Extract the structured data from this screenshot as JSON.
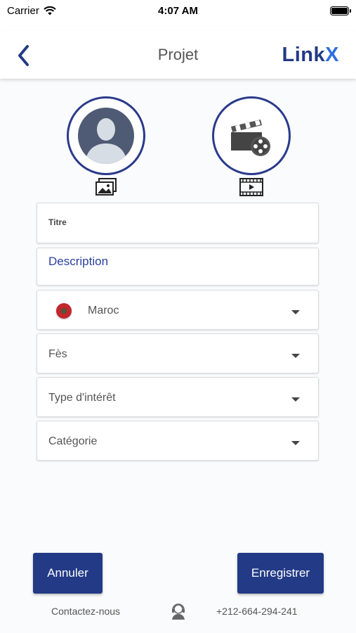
{
  "status": {
    "carrier": "Carrier",
    "time": "4:07 AM"
  },
  "nav": {
    "title": "Projet",
    "brand_main": "Link",
    "brand_accent": "X"
  },
  "form": {
    "title_label": "Titre",
    "description_label": "Description",
    "country": "Maroc",
    "city": "Fès",
    "interest_placeholder": "Type d'intérêt",
    "category_placeholder": "Catégorie"
  },
  "buttons": {
    "cancel": "Annuler",
    "save": "Enregistrer"
  },
  "footer": {
    "contact_label": "Contactez-nous",
    "phone": "+212-664-294-241"
  },
  "colors": {
    "primary": "#233a86",
    "accent": "#2f6fe0",
    "label_blue": "#2a3fa0"
  },
  "icons": {
    "avatar": "user-avatar-icon",
    "video": "clapperboard-icon",
    "gallery": "image-gallery-icon",
    "film": "film-play-icon",
    "support": "support-agent-icon"
  }
}
